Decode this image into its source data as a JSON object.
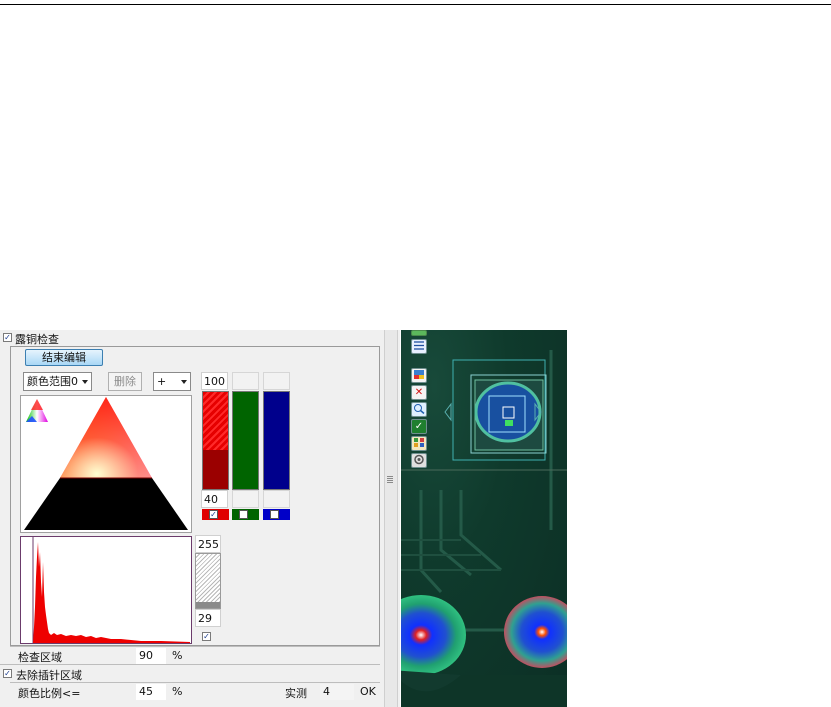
{
  "section": {
    "enabled_checkbox_label": "露铜检查",
    "end_edit_button": "结束编辑",
    "color_range_select": "颜色范围0",
    "delete_button": "删除",
    "mode_select": "+"
  },
  "color_channels": {
    "percent_max": "100",
    "percent_min": "40",
    "red_selected": "✓",
    "colors": {
      "red": "#e00000",
      "dark_red": "#9b0000",
      "green": "#006400",
      "blue": "#00008c"
    }
  },
  "histogram": {
    "upper_value": "255",
    "lower_value": "29",
    "enabled": "✓"
  },
  "settings": {
    "inspect_area_label": "检查区域",
    "inspect_area_value": "90",
    "inspect_area_unit": "%",
    "remove_pin_checkbox": "✓",
    "remove_pin_label": "去除插针区域",
    "color_ratio_label": "颜色比例<=",
    "color_ratio_value": "45",
    "color_ratio_unit": "%",
    "measured_label": "实测",
    "measured_value": "4",
    "result": "OK"
  },
  "icons": {
    "toolbar": [
      "comment-icon",
      "list-icon",
      "image-icon",
      "close-icon",
      "zoom-icon",
      "check-icon",
      "grid-icon",
      "settings-icon"
    ]
  }
}
